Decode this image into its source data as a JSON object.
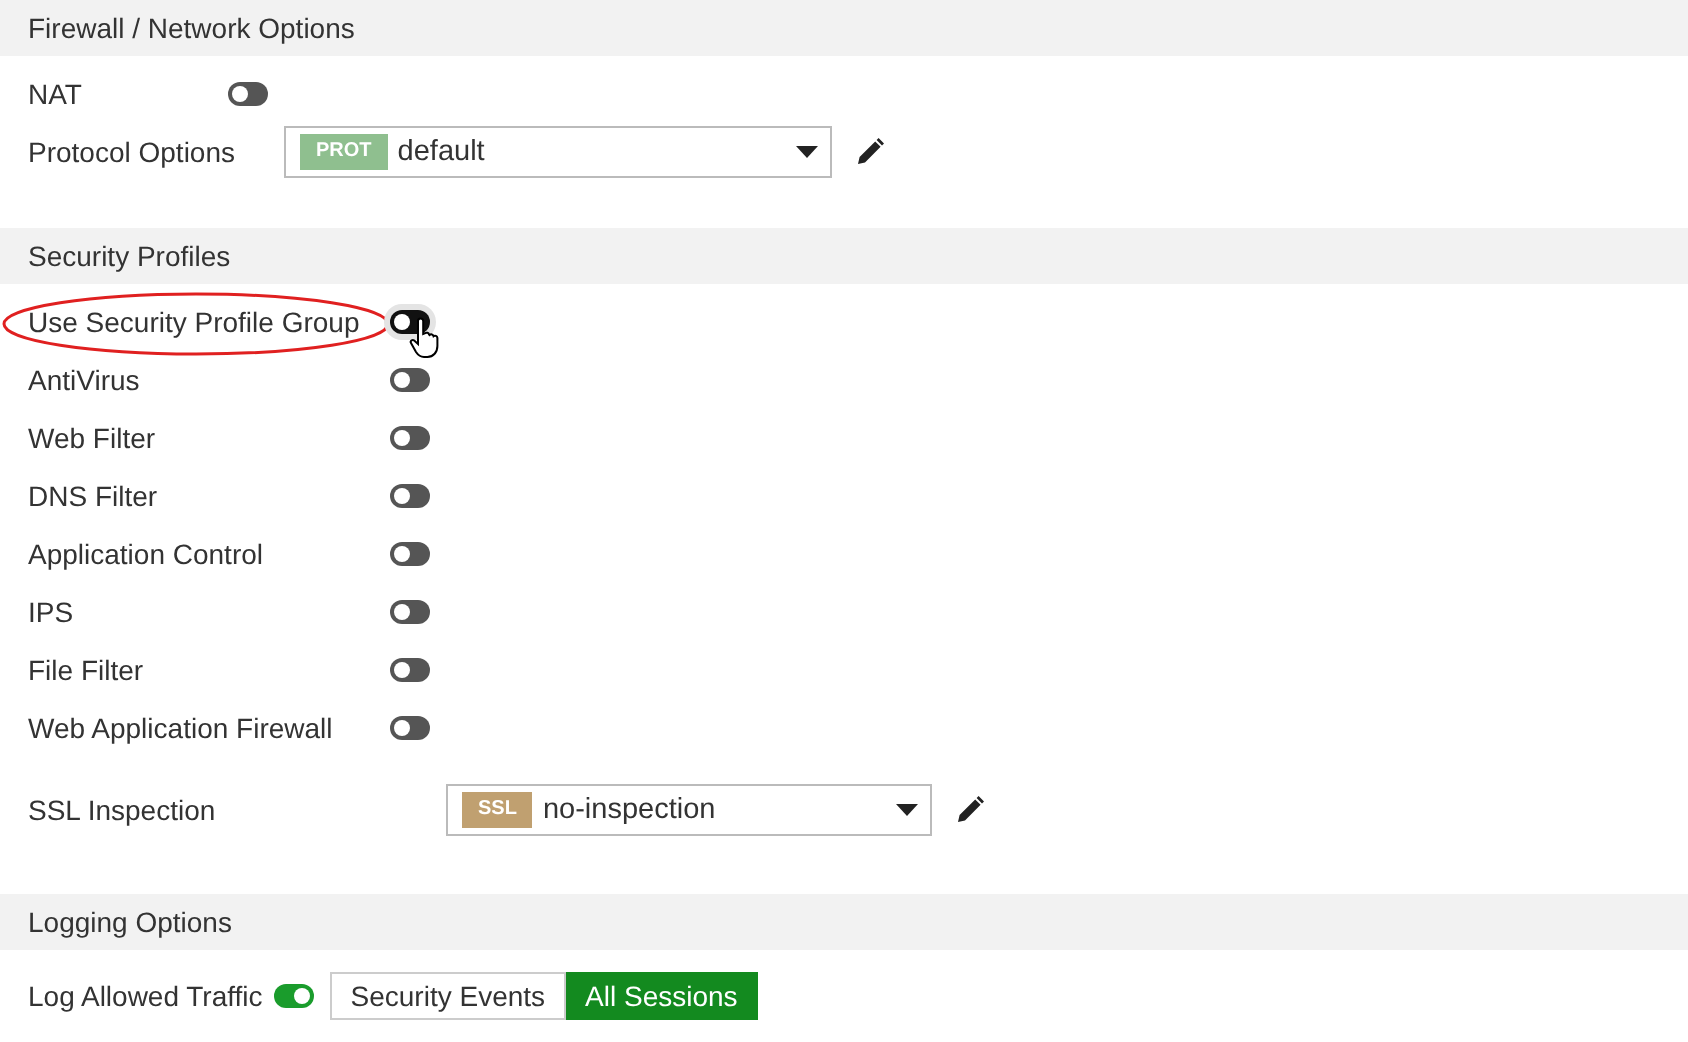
{
  "sections": [
    {
      "title": "Firewall / Network Options",
      "rows": [
        {
          "kind": "toggle",
          "label": "NAT",
          "on": false,
          "hovered": false,
          "annotated": false
        },
        {
          "kind": "select",
          "label": "Protocol Options",
          "tag": "PROT",
          "color": "#8fbf8f",
          "value": "default"
        }
      ]
    },
    {
      "title": "Security Profiles",
      "rows": [
        {
          "kind": "toggle",
          "label": "Use Security Profile Group",
          "on": false,
          "hovered": true,
          "annotated": true
        },
        {
          "kind": "toggle",
          "label": "AntiVirus",
          "on": false,
          "hovered": false,
          "annotated": false
        },
        {
          "kind": "toggle",
          "label": "Web Filter",
          "on": false,
          "hovered": false,
          "annotated": false
        },
        {
          "kind": "toggle",
          "label": "DNS Filter",
          "on": false,
          "hovered": false,
          "annotated": false
        },
        {
          "kind": "toggle",
          "label": "Application Control",
          "on": false,
          "hovered": false,
          "annotated": false
        },
        {
          "kind": "toggle",
          "label": "IPS",
          "on": false,
          "hovered": false,
          "annotated": false
        },
        {
          "kind": "toggle",
          "label": "File Filter",
          "on": false,
          "hovered": false,
          "annotated": false
        },
        {
          "kind": "toggle",
          "label": "Web Application Firewall",
          "on": false,
          "hovered": false,
          "annotated": false
        },
        {
          "kind": "select",
          "label": "SSL Inspection",
          "tag": "SSL",
          "color": "#c0a070",
          "value": "no-inspection"
        }
      ]
    },
    {
      "title": "Logging Options",
      "rows": [
        {
          "kind": "log",
          "label": "Log Allowed Traffic",
          "on": true,
          "options": [
            {
              "label": "Security Events",
              "selected": false
            },
            {
              "label": "All Sessions",
              "selected": true
            }
          ]
        }
      ]
    }
  ]
}
